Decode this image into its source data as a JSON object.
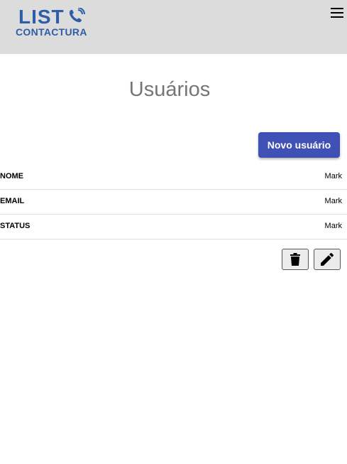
{
  "header": {
    "logo_title": "LIST",
    "logo_subtitle": "CONTACTURA",
    "brand_color": "#2f5da8",
    "menu_icon": "hamburger-menu-icon"
  },
  "main": {
    "title": "Usuários",
    "new_user_label": "Novo usuário",
    "accent_color": "#3f51b5"
  },
  "details": [
    {
      "label": "NOME",
      "value": "Mark"
    },
    {
      "label": "EMAIL",
      "value": "Mark"
    },
    {
      "label": "STATUS",
      "value": "Mark"
    }
  ],
  "actions": {
    "delete_icon": "trash-icon",
    "edit_icon": "pencil-icon"
  }
}
